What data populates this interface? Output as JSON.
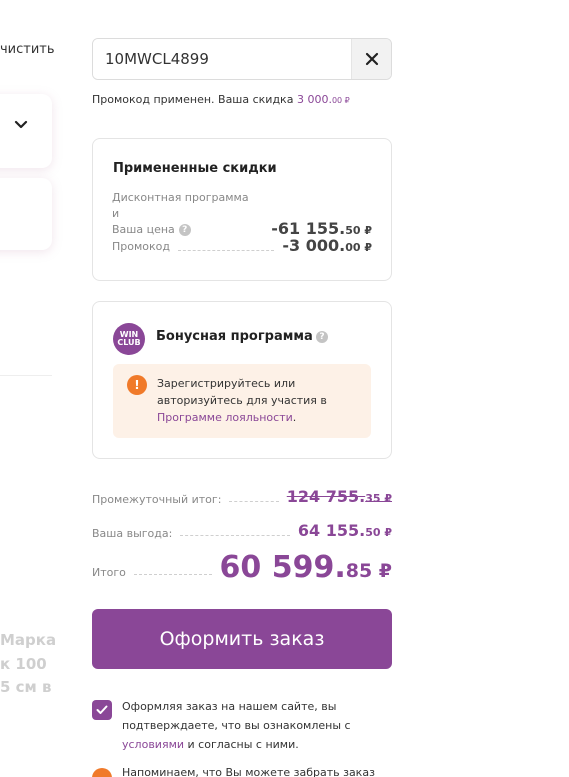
{
  "left": {
    "clear_label": "чистить",
    "ghost_lines": [
      "Марка",
      "к 100",
      "5 см в"
    ]
  },
  "promo": {
    "code_value": "10MWCL4899",
    "message_prefix": "Промокод применен. Ваша скидка",
    "discount_rub": "3 000.",
    "discount_kop": "00 ₽"
  },
  "discounts": {
    "title": "Примененные скидки",
    "rows": [
      {
        "label_line1": "Дисконтная программа и",
        "label_line2": "Ваша цена",
        "value": "-61 155.",
        "kop": "50 ₽"
      },
      {
        "label": "Промокод",
        "value": "-3 000.",
        "kop": "00 ₽"
      }
    ]
  },
  "bonus": {
    "logo_top": "WIN",
    "logo_bottom": "CLUB",
    "title": "Бонусная программа",
    "notice_text": "Зарегистрируйтесь или авторизуйтесь для участия в",
    "notice_link": "Программе лояльности",
    "notice_end": "."
  },
  "totals": {
    "subtotal_label": "Промежуточный итог:",
    "subtotal_value": "124 755.",
    "subtotal_kop": "35 ₽",
    "benefit_label": "Ваша выгода:",
    "benefit_value": "64 155.",
    "benefit_kop": "50 ₽",
    "total_label": "Итого",
    "total_value": "60 599.",
    "total_kop": "85 ₽"
  },
  "order_button": "Оформить заказ",
  "agreement": {
    "text_before": "Оформляя заказ на нашем сайте, вы подтверждаете, что вы ознакомлены с",
    "link": "условиями",
    "text_after": "и согласны с ними."
  },
  "reminder": "Напоминаем, что Вы можете забрать заказ",
  "colors": {
    "accent": "#8a4797",
    "warning": "#f07a2a",
    "notice_bg": "#fdf1e7"
  }
}
